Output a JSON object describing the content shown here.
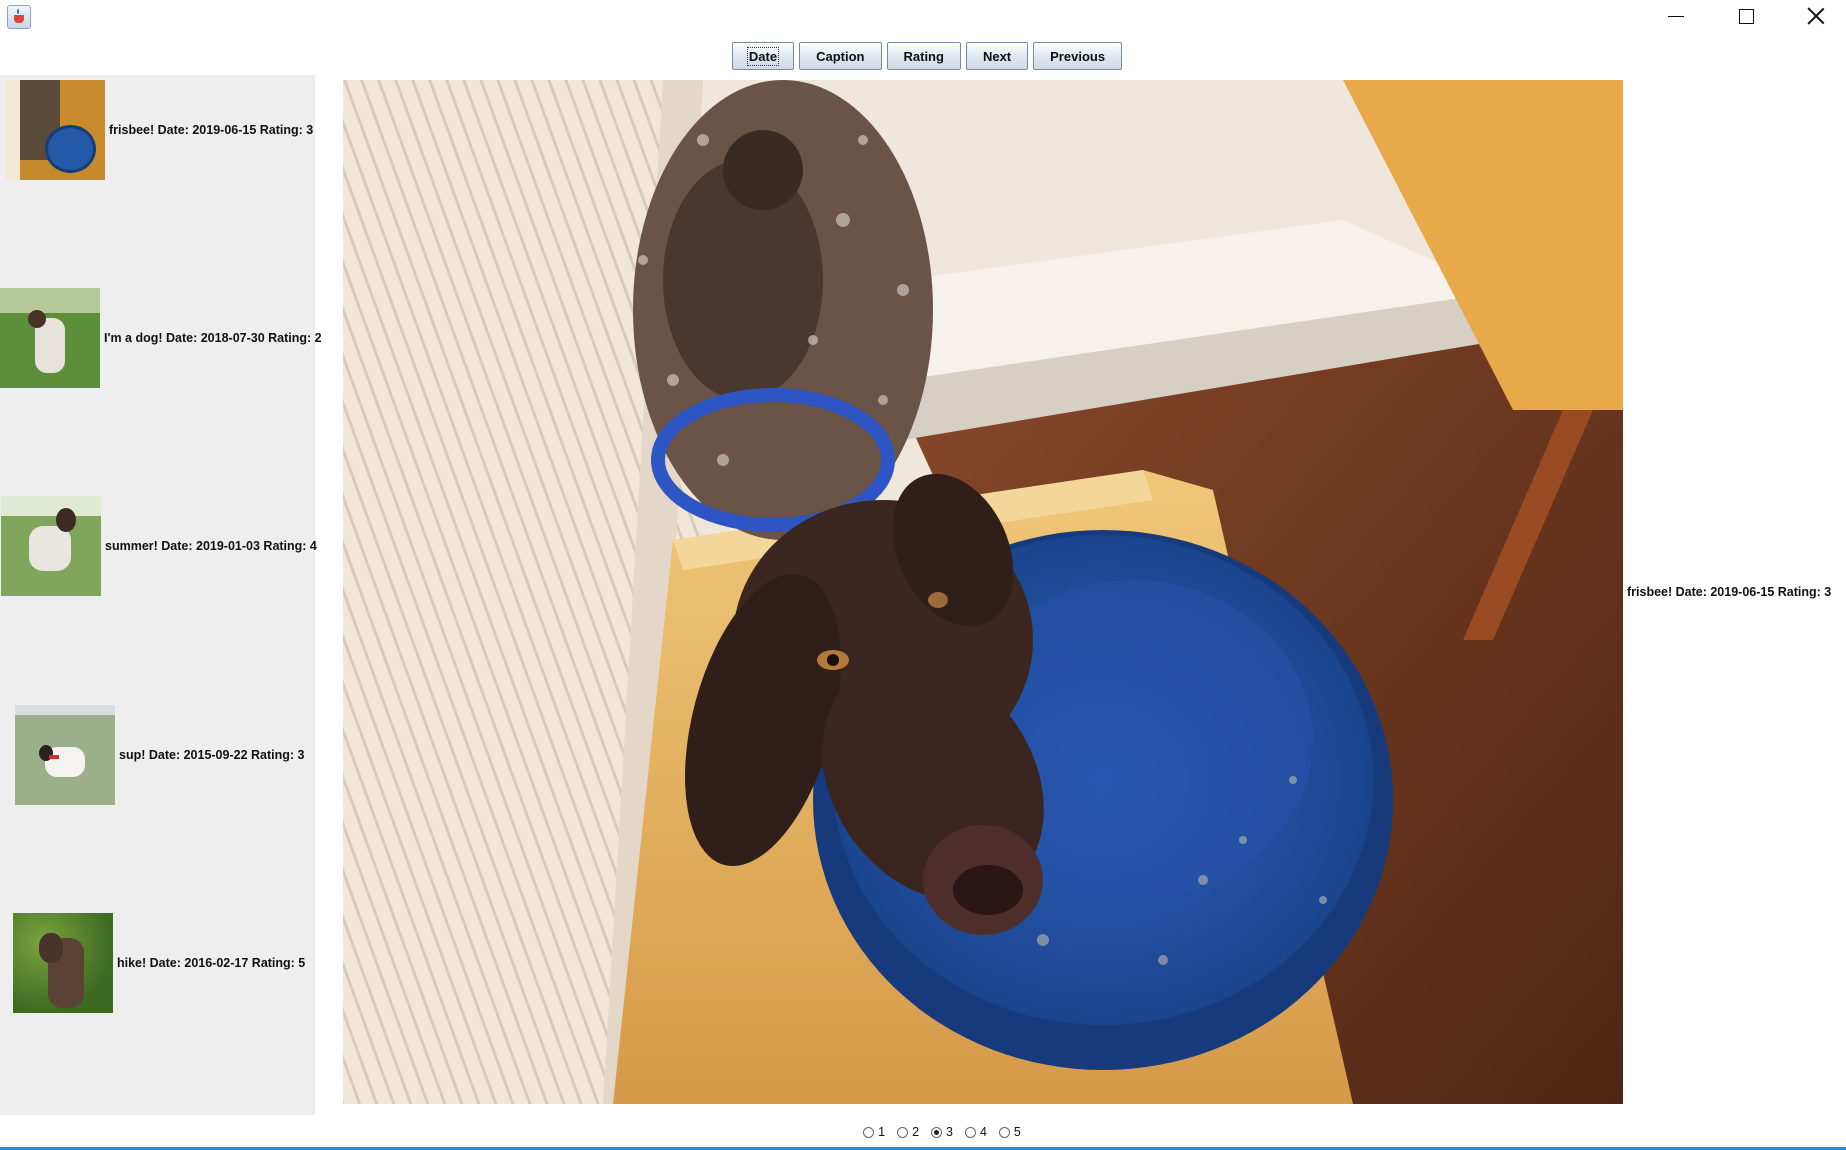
{
  "toolbar": {
    "buttons": [
      "Date",
      "Caption",
      "Rating",
      "Next",
      "Previous"
    ]
  },
  "sidebar": {
    "items": [
      {
        "label": "frisbee! Date: 2019-06-15 Rating: 3"
      },
      {
        "label": "I'm a dog! Date: 2018-07-30 Rating: 2"
      },
      {
        "label": "summer! Date: 2019-01-03 Rating: 4"
      },
      {
        "label": "sup! Date: 2015-09-22 Rating: 3"
      },
      {
        "label": "hike! Date: 2016-02-17 Rating: 5"
      }
    ]
  },
  "viewer": {
    "caption": "frisbee! Date: 2019-06-15 Rating: 3"
  },
  "rating": {
    "options": [
      "1",
      "2",
      "3",
      "4",
      "5"
    ],
    "selected": "3"
  },
  "colors": {
    "accent_line": "#1d8fd8",
    "panel_bg": "#eeeeee"
  }
}
